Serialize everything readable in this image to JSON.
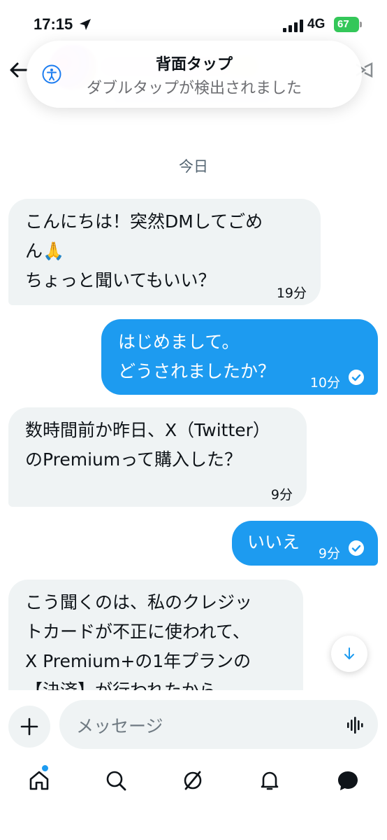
{
  "status_bar": {
    "time": "17:15",
    "network": "4G",
    "battery": "67"
  },
  "banner": {
    "title": "背面タップ",
    "subtitle": "ダブルタップが検出されました"
  },
  "date_separator": "今日",
  "messages": [
    {
      "direction": "incoming",
      "lines": [
        "こんにちは！突然DMしてごめ",
        "ん🙏",
        "ちょっと聞いてもいい？"
      ],
      "time": "19分"
    },
    {
      "direction": "outgoing",
      "lines": [
        "はじめまして。",
        "どうされましたか？"
      ],
      "time": "10分",
      "read": true
    },
    {
      "direction": "incoming",
      "lines": [
        "数時間前か昨日、X（Twitter）",
        "のPremiumって購入した？"
      ],
      "time": "9分"
    },
    {
      "direction": "outgoing",
      "lines": [
        "いいえ"
      ],
      "time": "9分",
      "read": true
    },
    {
      "direction": "incoming",
      "lines": [
        "こう聞くのは、私のクレジッ",
        "トカードが不正に使われて、",
        "X Premium+の1年プランの",
        "【決済】が行われたから"
      ]
    }
  ],
  "composer": {
    "placeholder": "メッセージ"
  },
  "tab_bar": {
    "items": [
      "home-icon",
      "search-icon",
      "grok-icon",
      "notifications-icon",
      "messages-icon"
    ],
    "home_has_badge": true
  },
  "colors": {
    "accent": "#1d9bf0",
    "incoming_bubble": "#eff3f4",
    "battery": "#34c759"
  }
}
